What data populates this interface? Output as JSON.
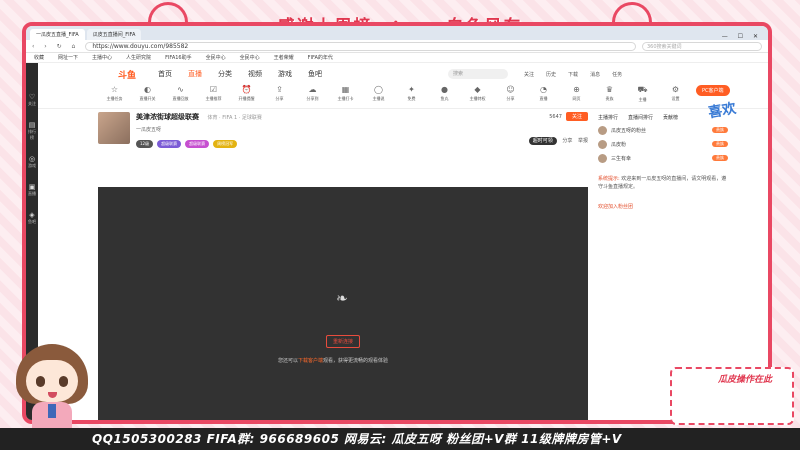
{
  "overlay": {
    "top_title_a": "感谢上周榜一：",
    "top_title_b": "白色风车",
    "cam_label": "瓜皮操作在此",
    "bottom_banner": "QQ1505300283  FIFA群: 966689605  网易云: 瓜皮五呀  粉丝团+V群  11级牌牌房管+V",
    "right_deco": "喜欢"
  },
  "browser": {
    "tabs": [
      "一瓜皮五直播_FIFA",
      "瓜皮五直播间_FIFA"
    ],
    "url": "https://www.douyu.com/985582",
    "search_placeholder": "360搜索关键词",
    "bookmarks": [
      "收藏",
      "网址一下",
      "主播中心",
      "人生研究院",
      "FIFA16助手",
      "全民中心",
      "全民中心",
      "王者荣耀",
      "FIFA的年代"
    ]
  },
  "site": {
    "logo": "斗鱼",
    "nav": [
      "首页",
      "直播",
      "分类",
      "视频",
      "游戏",
      "鱼吧"
    ],
    "active_nav": "直播",
    "search_placeholder": "搜索",
    "header_icons": [
      "关注",
      "历史",
      "下载",
      "消息",
      "任务"
    ],
    "rail": [
      "关注",
      "排行榜",
      "游戏",
      "直播",
      "鱼吧"
    ],
    "categories": [
      "主播任务",
      "直播开关",
      "直播回放",
      "主播推荐",
      "开播提醒",
      "分享",
      "分享到",
      "主播打卡",
      "主播说",
      "免费",
      "鱼丸",
      "主播特权",
      "分享",
      "直播",
      "网页",
      "贵族",
      "主播",
      "设置"
    ],
    "pc_button": "PC客户端"
  },
  "room": {
    "title": "美津浓街球超级联赛",
    "category": "体育 · FIFA 1 · 足球联赛",
    "anchor": "一瓜皮五呀",
    "tags": [
      "12级",
      "超级联赛",
      "超级联赛",
      "周榜冠军"
    ],
    "follow_count": "5647",
    "follow_label": "关注",
    "share": "分享",
    "report": "举报",
    "lottery": "超时可领"
  },
  "video": {
    "button": "重新连接",
    "message_a": "您还可以",
    "message_b": "下载客户端",
    "message_c": "观看，获得更流畅的观看体验"
  },
  "chat": {
    "head": [
      "主播排行",
      "直播间排行",
      "贡献榜"
    ],
    "rank": [
      {
        "name": "瓜皮五呀的粉丝",
        "tag": "贵族"
      },
      {
        "name": "瓜皮粉",
        "tag": "贵族"
      },
      {
        "name": "三生有幸",
        "tag": "贵族"
      }
    ],
    "sys_label": "系统提示:",
    "sys_msg": "欢迎来到一瓜皮五呀的直播间，请文明观看，遵守斗鱼直播规定。",
    "join_label": "欢迎加入粉丝团"
  }
}
